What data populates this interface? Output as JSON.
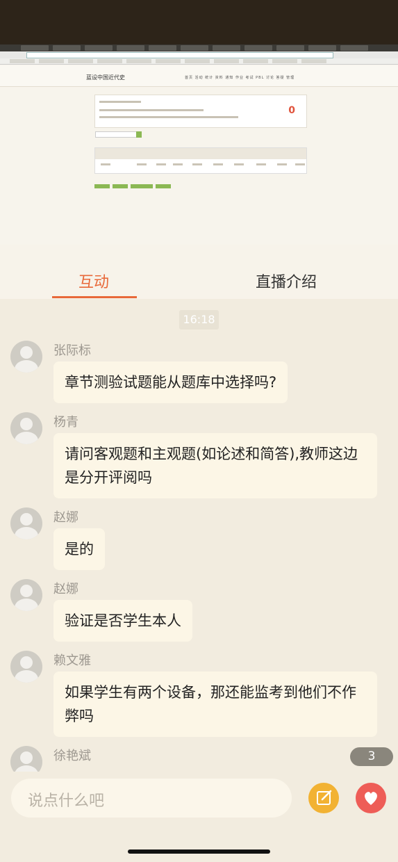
{
  "video": {
    "course_title": "蓝设中国近代史",
    "nav": "首页 活动 统计 资料 通知 作业 考试 PBL 讨论 答疑 管理",
    "score": "0"
  },
  "tabs": [
    {
      "label": "互动"
    },
    {
      "label": "直播介绍"
    }
  ],
  "chat": {
    "time": "16:18",
    "messages": [
      {
        "user": "张际标",
        "text": "章节测验试题能从题库中选择吗?"
      },
      {
        "user": "杨青",
        "text": "请问客观题和主观题(如论述和简答),教师这边是分开评阅吗"
      },
      {
        "user": "赵娜",
        "text": "是的"
      },
      {
        "user": "赵娜",
        "text": "验证是否学生本人"
      },
      {
        "user": "赖文雅",
        "text": "如果学生有两个设备，那还能监考到他们不作弊吗"
      },
      {
        "user": "徐艳斌",
        "text": ""
      }
    ],
    "unread_count": "3"
  },
  "input": {
    "placeholder": "说点什么吧"
  },
  "colors": {
    "accent": "#e8693a",
    "edit": "#f2b233",
    "like": "#ee5d57"
  }
}
